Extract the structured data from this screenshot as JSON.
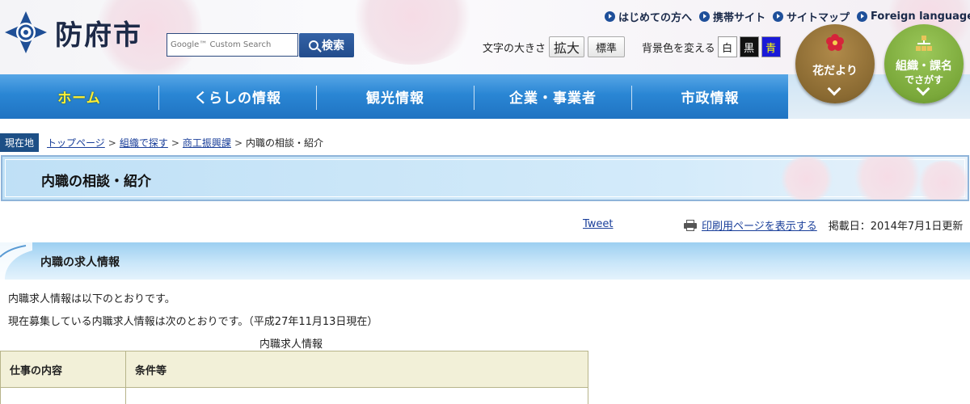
{
  "site": {
    "name": "防府市"
  },
  "search": {
    "placeholder": "Google™ Custom Search",
    "button_label": "検索"
  },
  "top_links": [
    {
      "label": "はじめての方へ"
    },
    {
      "label": "携帯サイト"
    },
    {
      "label": "サイトマップ"
    },
    {
      "label": "Foreign language"
    }
  ],
  "font_size": {
    "label": "文字の大きさ",
    "enlarge": "拡大",
    "standard": "標準"
  },
  "background": {
    "label": "背景色を変える",
    "white": "白",
    "black": "黒",
    "blue": "青"
  },
  "feature_buttons": {
    "flower": {
      "label": "花だより"
    },
    "org": {
      "label_line1": "組織・課名",
      "label_line2": "でさがす"
    }
  },
  "nav": {
    "items": [
      {
        "label": "ホーム"
      },
      {
        "label": "くらしの情報"
      },
      {
        "label": "観光情報"
      },
      {
        "label": "企業・事業者"
      },
      {
        "label": "市政情報"
      }
    ]
  },
  "breadcrumb": {
    "badge": "現在地",
    "items": [
      "トップページ",
      "組織で探す",
      "商工振興課"
    ],
    "current": "内職の相談・紹介",
    "separator": ">"
  },
  "page": {
    "title": "内職の相談・紹介"
  },
  "tools": {
    "tweet": "Tweet",
    "print": "印刷用ページを表示する",
    "posted": "掲載日：2014年7月1日更新"
  },
  "section": {
    "title": "内職の求人情報",
    "para1": "内職求人情報は以下のとおりです。",
    "para2": "現在募集している内職求人情報は次のとおりです。（平成27年11月13日現在）",
    "caption": "内職求人情報",
    "table": {
      "headers": [
        "仕事の内容",
        "条件等"
      ]
    }
  },
  "colors": {
    "nav_blue": "#2a86d4",
    "active_nav_text": "#ffee33",
    "flower_button": "#8a6a32",
    "org_button": "#7aa83a",
    "link": "#1a3f9a"
  }
}
